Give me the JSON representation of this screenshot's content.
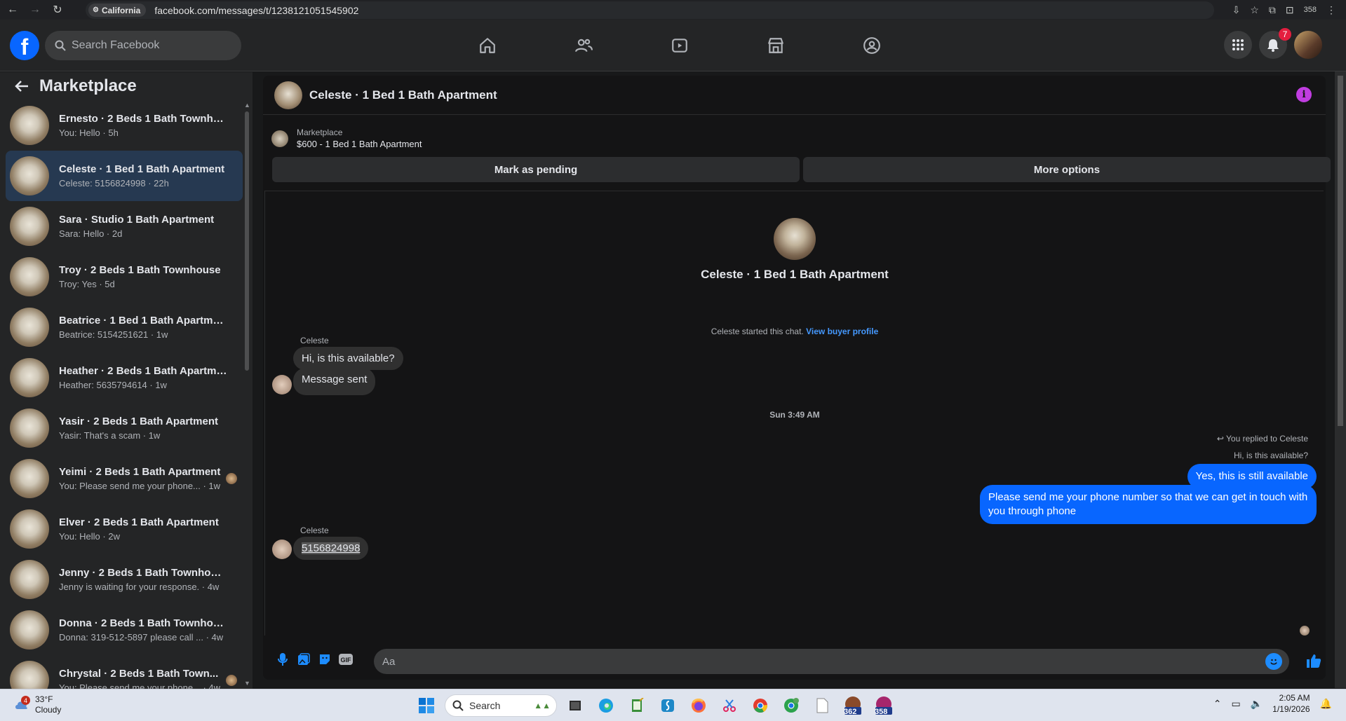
{
  "browser": {
    "location_chip": "California",
    "url": "facebook.com/messages/t/1238121051545902",
    "counter": "358"
  },
  "header": {
    "logo_letter": "f",
    "search_placeholder": "Search Facebook",
    "notifications_count": "7"
  },
  "sidebar": {
    "title": "Marketplace",
    "conversations": [
      {
        "name": "Ernesto · 2 Beds 1 Bath Townhou...",
        "sub": "You: Hello · 5h"
      },
      {
        "name": "Celeste · 1 Bed 1 Bath Apartment",
        "sub": "Celeste: 5156824998 · 22h",
        "active": true
      },
      {
        "name": "Sara · Studio 1 Bath Apartment",
        "sub": "Sara: Hello · 2d"
      },
      {
        "name": "Troy · 2 Beds 1 Bath Townhouse",
        "sub": "Troy: Yes · 5d"
      },
      {
        "name": "Beatrice · 1 Bed 1 Bath Apartment",
        "sub": "Beatrice: 5154251621 · 1w"
      },
      {
        "name": "Heather · 2 Beds 1 Bath Apartme...",
        "sub": "Heather: 5635794614 · 1w"
      },
      {
        "name": "Yasir · 2 Beds 1 Bath Apartment",
        "sub": "Yasir: That's a scam · 1w"
      },
      {
        "name": "Yeimi · 2 Beds 1 Bath Apartment",
        "sub": "You: Please send me your phone... · 1w"
      },
      {
        "name": "Elver · 2 Beds 1 Bath Apartment",
        "sub": "You: Hello · 2w"
      },
      {
        "name": "Jenny · 2 Beds 1 Bath Townhouse",
        "sub": "Jenny is waiting for your response. · 4w"
      },
      {
        "name": "Donna · 2 Beds 1 Bath Townhouse",
        "sub": "Donna: 319-512-5897 please call ... · 4w"
      },
      {
        "name": "Chrystal · 2 Beds 1 Bath Town...",
        "sub": "You: Please send me your phone... · 4w"
      }
    ]
  },
  "chat": {
    "title": "Celeste · 1 Bed 1 Bath Apartment",
    "listing_source": "Marketplace",
    "listing_title": "$600 - 1 Bed 1 Bath Apartment",
    "mark_pending_label": "Mark as pending",
    "more_options_label": "More options",
    "intro_name": "Celeste · 1 Bed 1 Bath Apartment",
    "started_text": "Celeste started this chat.",
    "view_profile_label": "View buyer profile",
    "sender_name": "Celeste",
    "incoming_1": "Hi, is this available?",
    "incoming_2": "Message sent",
    "timestamp": "Sun 3:49 AM",
    "replied_label": "You replied to Celeste",
    "quoted_text": "Hi, is this available?",
    "outgoing_1": "Yes, this is still available",
    "outgoing_2": "Please send me your phone  number so that we can get in touch with you through phone",
    "sender_name_2": "Celeste",
    "incoming_3": "5156824998",
    "composer_placeholder": "Aa"
  },
  "taskbar": {
    "weather_badge": "4",
    "temperature": "33°F",
    "condition": "Cloudy",
    "search_label": "Search",
    "app_badge_1": "362",
    "app_badge_2": "358",
    "time": "2:05 AM",
    "date": "1/19/2026"
  },
  "colors": {
    "facebook_blue": "#0866ff",
    "active_conversation": "#263951",
    "notification_red": "#e41e3f",
    "info_icon": "#c03de0"
  }
}
